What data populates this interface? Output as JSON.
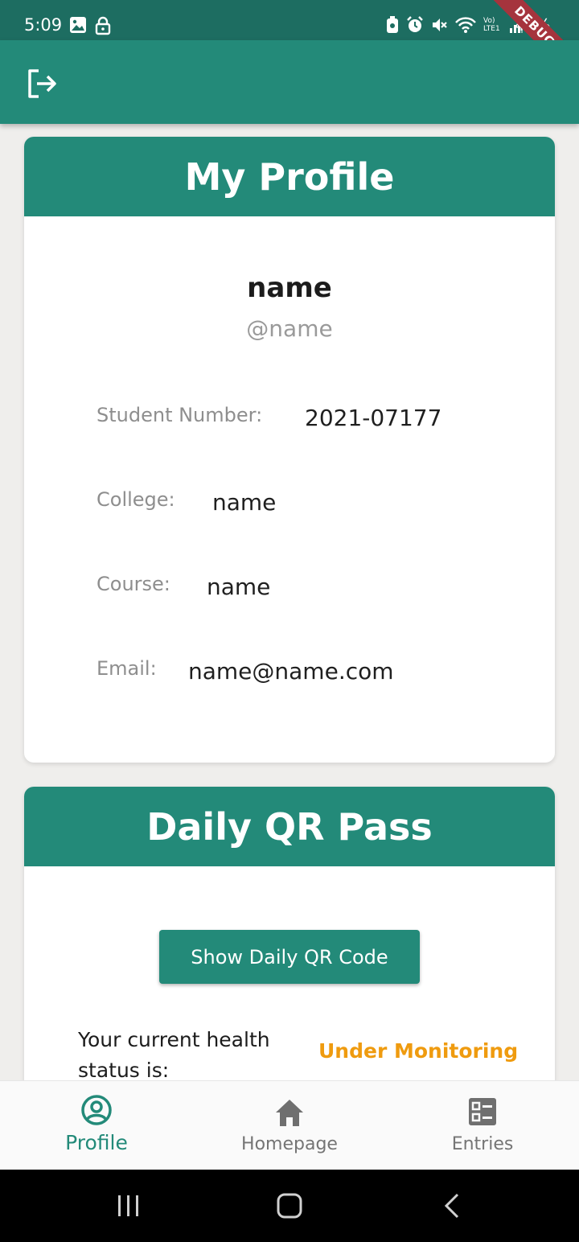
{
  "status_bar": {
    "time": "5:09",
    "battery": "45%",
    "network_badge": "Vo) LTE1",
    "debug_label": "DEBUG"
  },
  "app_bar": {
    "logout_icon": "logout-icon"
  },
  "profile_card": {
    "title": "My Profile",
    "name": "name",
    "username": "@name",
    "fields": [
      {
        "label": "Student Number:",
        "value": "2021-07177"
      },
      {
        "label": "College:",
        "value": "name"
      },
      {
        "label": "Course:",
        "value": "name"
      },
      {
        "label": "Email:",
        "value": "name@name.com"
      }
    ]
  },
  "qr_card": {
    "title": "Daily QR Pass",
    "button_label": "Show Daily QR Code",
    "health_label": "Your current health status is:",
    "health_status": "Under Monitoring",
    "health_status_color": "#ef9b0f"
  },
  "bottom_nav": {
    "items": [
      {
        "label": "Profile",
        "icon": "account-circle-icon",
        "active": true
      },
      {
        "label": "Homepage",
        "icon": "home-icon",
        "active": false
      },
      {
        "label": "Entries",
        "icon": "list-alt-icon",
        "active": false
      }
    ]
  },
  "colors": {
    "primary": "#238a79",
    "status_bar": "#1d6d61",
    "background": "#efeeec"
  }
}
